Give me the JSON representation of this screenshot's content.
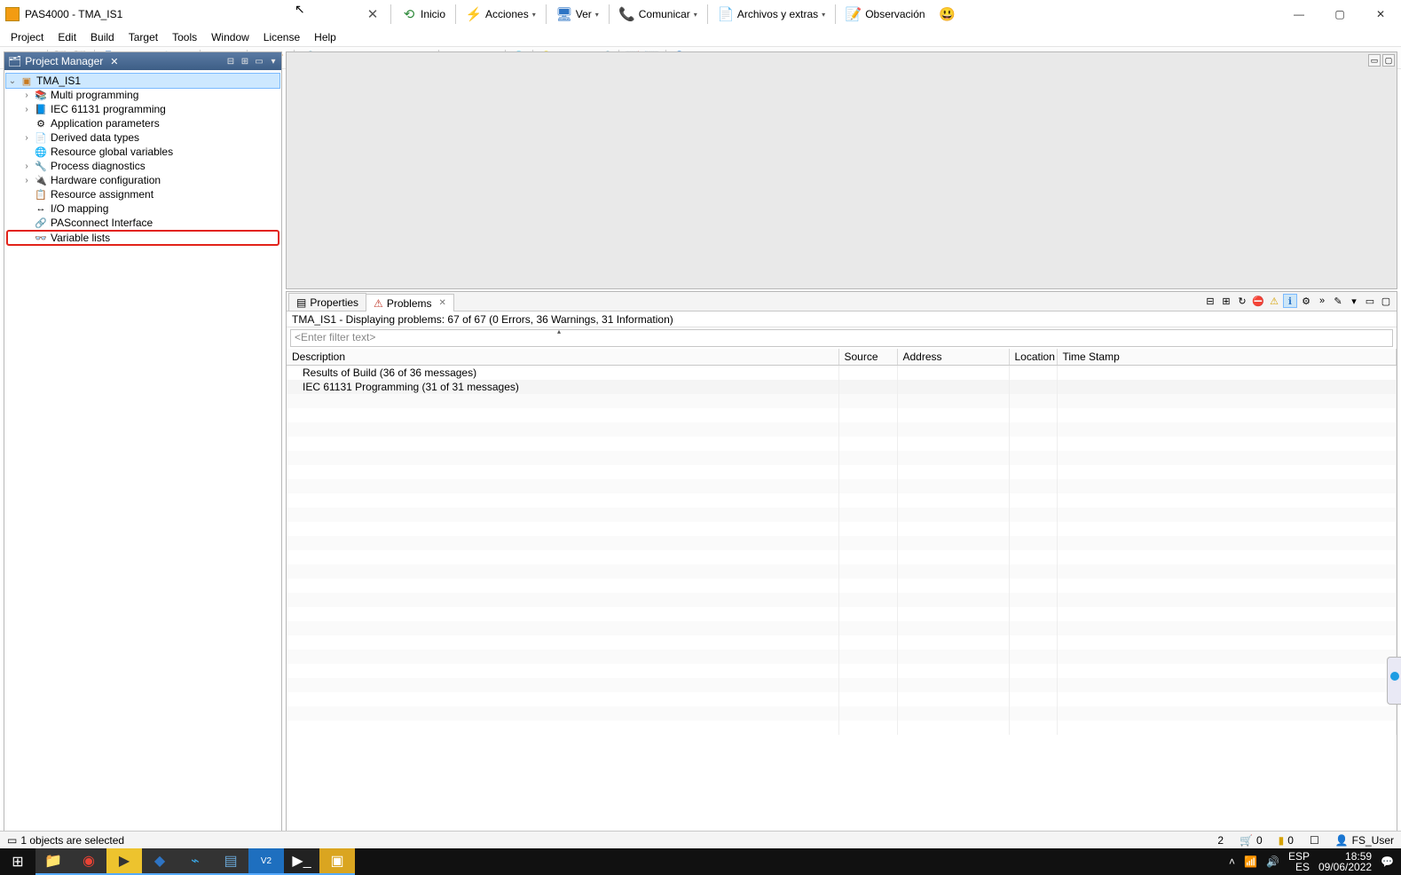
{
  "window": {
    "title": "PAS4000 - TMA_IS1"
  },
  "menu": [
    "Project",
    "Edit",
    "Build",
    "Target",
    "Tools",
    "Window",
    "License",
    "Help"
  ],
  "bigbar": {
    "close": {
      "glyph": "✕",
      "color": "#555"
    },
    "inicio": {
      "label": "Inicio",
      "glyph": "⟲",
      "color": "#5aa63f"
    },
    "acciones": {
      "label": "Acciones",
      "glyph": "⚡",
      "color": "#e8a70e"
    },
    "ver": {
      "label": "Ver",
      "glyph": "🖥",
      "color": "#3b78c4"
    },
    "comunicar": {
      "label": "Comunicar",
      "glyph": "📞",
      "color": "#3b78c4"
    },
    "archivos": {
      "label": "Archivos y extras",
      "glyph": "📄",
      "color": "#c7851a"
    },
    "observ": {
      "label": "Observación",
      "glyph": "📝",
      "color": "#3b78c4"
    },
    "smiley": {
      "glyph": "😃"
    }
  },
  "pm": {
    "tab": "Project Manager",
    "root": "TMA_IS1",
    "items": [
      {
        "label": "Multi programming",
        "exp": true,
        "ico": "📚"
      },
      {
        "label": "IEC 61131 programming",
        "exp": true,
        "ico": "📘"
      },
      {
        "label": "Application parameters",
        "exp": false,
        "ico": "⚙"
      },
      {
        "label": "Derived data types",
        "exp": true,
        "ico": "📄"
      },
      {
        "label": "Resource global variables",
        "exp": false,
        "ico": "🌐"
      },
      {
        "label": "Process diagnostics",
        "exp": true,
        "ico": "🔧"
      },
      {
        "label": "Hardware configuration",
        "exp": true,
        "ico": "🔌"
      },
      {
        "label": "Resource assignment",
        "exp": false,
        "ico": "📋"
      },
      {
        "label": "I/O mapping",
        "exp": false,
        "ico": "↔"
      },
      {
        "label": "PASconnect Interface",
        "exp": false,
        "ico": "🔗"
      },
      {
        "label": "Variable lists",
        "exp": false,
        "ico": "👓",
        "highlight": true
      }
    ]
  },
  "problems": {
    "tab_properties": "Properties",
    "tab_problems": "Problems",
    "summary": "TMA_IS1 - Displaying problems: 67 of 67 (0 Errors, 36 Warnings, 31 Information)",
    "filter_placeholder": "<Enter filter text>",
    "cols": {
      "description": "Description",
      "source": "Source",
      "address": "Address",
      "location": "Location",
      "timestamp": "Time Stamp"
    },
    "rows": [
      {
        "description": "Results of Build (36 of 36 messages)"
      },
      {
        "description": "IEC 61131 Programming (31 of 31 messages)"
      }
    ]
  },
  "status": {
    "selection": "1 objects are selected",
    "n1": "2",
    "cart": "0",
    "coins": "0",
    "user": "FS_User"
  },
  "tray": {
    "lang1": "ESP",
    "lang2": "ES",
    "time": "18:59",
    "date": "09/06/2022"
  }
}
